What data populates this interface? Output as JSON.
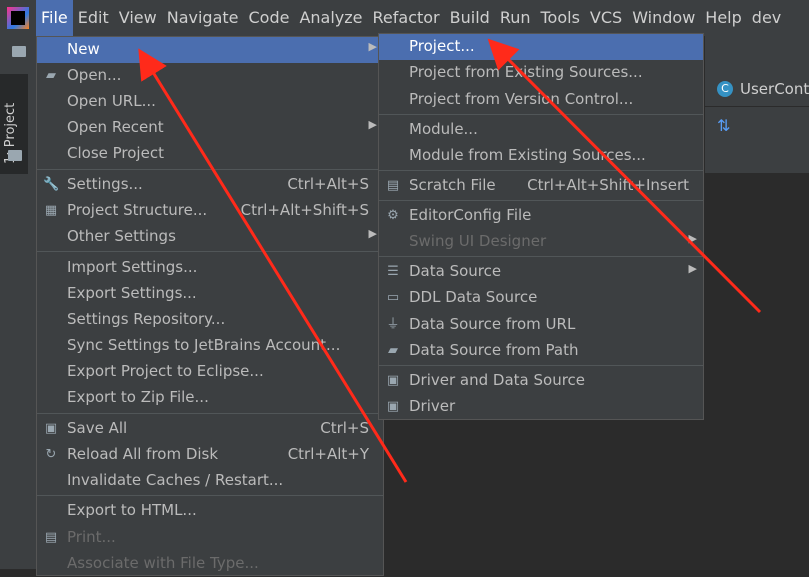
{
  "menubar": [
    "File",
    "Edit",
    "View",
    "Navigate",
    "Code",
    "Analyze",
    "Refactor",
    "Build",
    "Run",
    "Tools",
    "VCS",
    "Window",
    "Help",
    "dev"
  ],
  "sidebar_tab": "1: Project",
  "editor_tab": "UserCont",
  "file_menu": [
    {
      "label": "New",
      "arrow": true,
      "selected": true
    },
    {
      "label": "Open...",
      "icon": "folder-open-icon"
    },
    {
      "label": "Open URL..."
    },
    {
      "label": "Open Recent",
      "arrow": true
    },
    {
      "label": "Close Project"
    },
    {
      "label": "Settings...",
      "shortcut": "Ctrl+Alt+S",
      "icon": "wrench-icon"
    },
    {
      "label": "Project Structure...",
      "shortcut": "Ctrl+Alt+Shift+S",
      "icon": "project-structure-icon"
    },
    {
      "label": "Other Settings",
      "arrow": true
    },
    {
      "label": "Import Settings..."
    },
    {
      "label": "Export Settings..."
    },
    {
      "label": "Settings Repository..."
    },
    {
      "label": "Sync Settings to JetBrains Account..."
    },
    {
      "label": "Export Project to Eclipse..."
    },
    {
      "label": "Export to Zip File..."
    },
    {
      "label": "Save All",
      "shortcut": "Ctrl+S",
      "icon": "save-icon"
    },
    {
      "label": "Reload All from Disk",
      "shortcut": "Ctrl+Alt+Y",
      "icon": "reload-icon"
    },
    {
      "label": "Invalidate Caches / Restart..."
    },
    {
      "label": "Export to HTML..."
    },
    {
      "label": "Print...",
      "disabled": true,
      "icon": "print-icon"
    },
    {
      "label": "Associate with File Type...",
      "disabled": true
    }
  ],
  "new_menu": [
    {
      "label": "Project...",
      "selected": true
    },
    {
      "label": "Project from Existing Sources..."
    },
    {
      "label": "Project from Version Control..."
    },
    {
      "label": "Module..."
    },
    {
      "label": "Module from Existing Sources..."
    },
    {
      "label": "Scratch File",
      "shortcut": "Ctrl+Alt+Shift+Insert",
      "icon": "scratch-file-icon"
    },
    {
      "label": "EditorConfig File",
      "icon": "gear-icon"
    },
    {
      "label": "Swing UI Designer",
      "disabled": true,
      "arrow": true
    },
    {
      "label": "Data Source",
      "arrow": true,
      "icon": "database-icon"
    },
    {
      "label": "DDL Data Source",
      "icon": "ddl-icon"
    },
    {
      "label": "Data Source from URL",
      "icon": "plug-icon"
    },
    {
      "label": "Data Source from Path",
      "icon": "folder-icon"
    },
    {
      "label": "Driver and Data Source",
      "icon": "driver-icon"
    },
    {
      "label": "Driver",
      "icon": "driver-icon"
    }
  ],
  "colors": {
    "selection": "#4b6eaf",
    "menu_bg": "#3c3f41",
    "annotation": "#ff2a1a"
  }
}
